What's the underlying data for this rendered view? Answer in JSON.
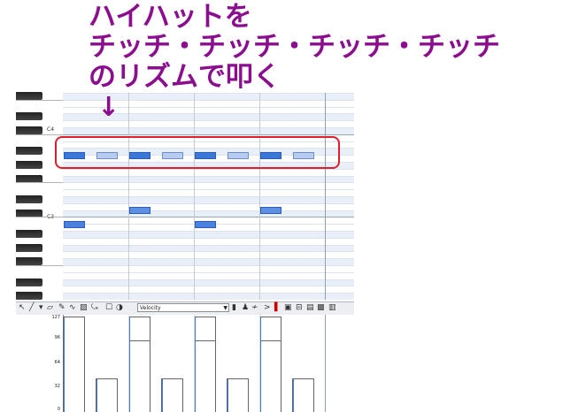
{
  "annotation": {
    "line1": "ハイハットを",
    "line2": "チッチ・チッチ・チッチ・チッチ",
    "line3": "のリズムで叩く",
    "arrow": "↓",
    "color": "#8a0e8e"
  },
  "piano": {
    "label_c4": "C4",
    "label_c3": "C3"
  },
  "toolbar": {
    "velocity_label": "Velocity"
  },
  "velocity_axis": [
    "127",
    "96",
    "64",
    "32",
    "0"
  ],
  "notes": {
    "hihat": [
      "accent",
      "normal",
      "accent",
      "normal",
      "accent",
      "normal",
      "accent",
      "normal"
    ],
    "snare_beats": [
      2,
      4
    ],
    "kick_beats": [
      1,
      3
    ]
  },
  "velocities": {
    "max": 127,
    "hihat_accent": 127,
    "hihat_normal": 45,
    "accent_inner": 96
  },
  "colors": {
    "highlight_box": "#e01f2a",
    "note_accent": "#3a78d8",
    "note_normal": "#b7cdef"
  }
}
